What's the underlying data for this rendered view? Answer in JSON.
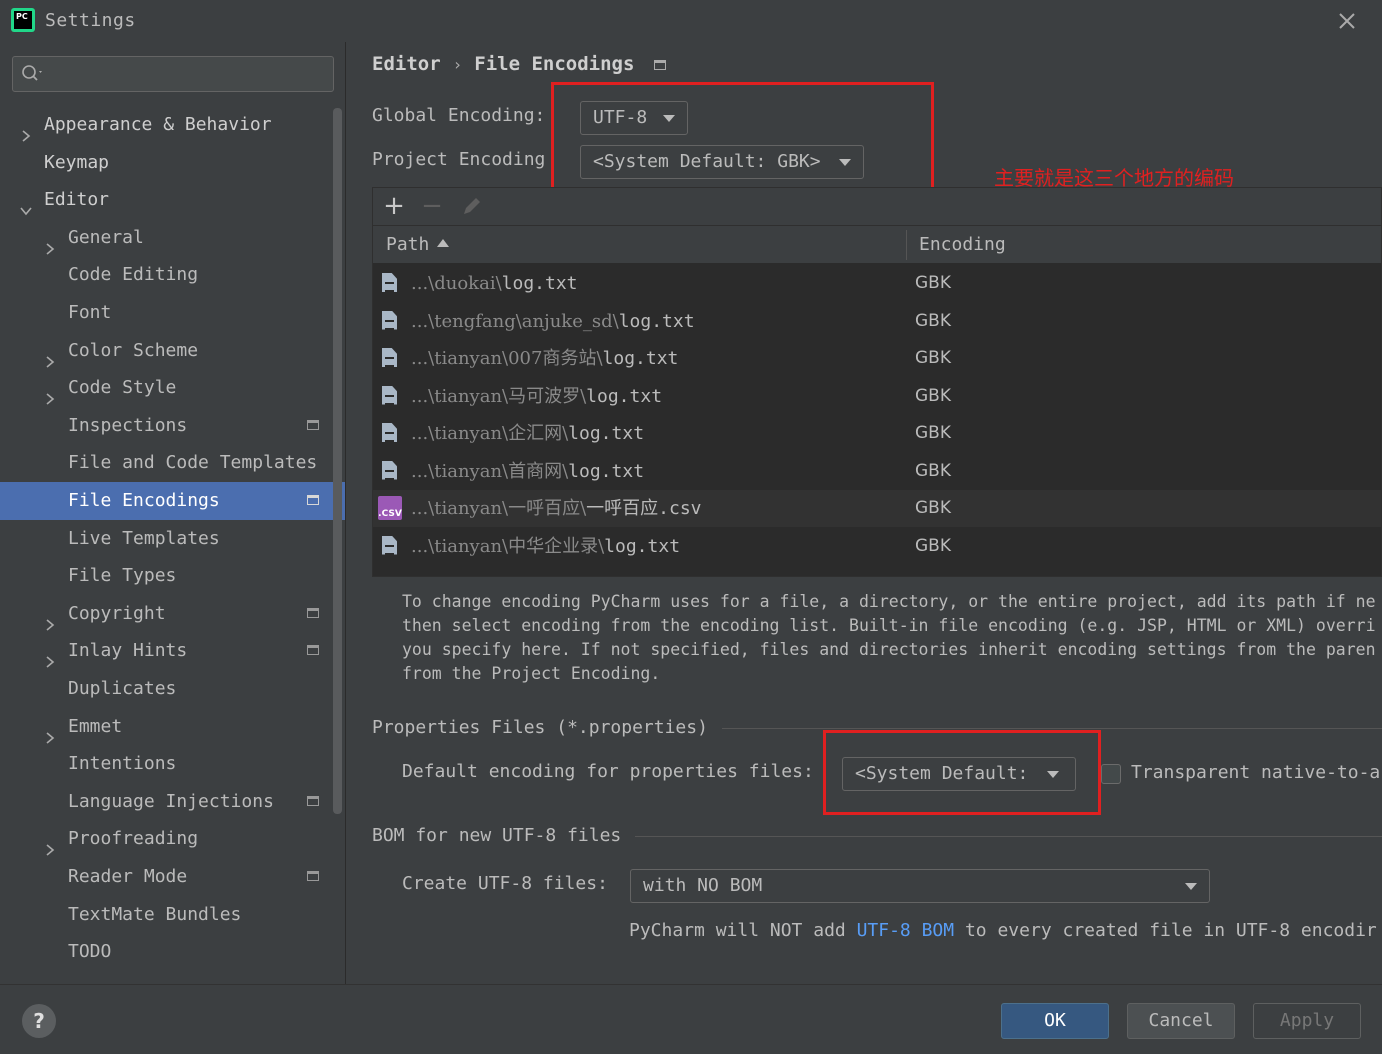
{
  "window": {
    "title": "Settings",
    "app_logo_text": "PC"
  },
  "search": {
    "placeholder": ""
  },
  "sidebar": {
    "items": [
      {
        "label": "Appearance & Behavior",
        "expandable": true,
        "expanded": false,
        "level": 0,
        "project_icon": false
      },
      {
        "label": "Keymap",
        "expandable": false,
        "level": 0,
        "project_icon": false
      },
      {
        "label": "Editor",
        "expandable": true,
        "expanded": true,
        "level": 0,
        "project_icon": false
      },
      {
        "label": "General",
        "expandable": true,
        "expanded": false,
        "level": 1,
        "project_icon": false
      },
      {
        "label": "Code Editing",
        "expandable": false,
        "level": 1,
        "project_icon": false
      },
      {
        "label": "Font",
        "expandable": false,
        "level": 1,
        "project_icon": false
      },
      {
        "label": "Color Scheme",
        "expandable": true,
        "expanded": false,
        "level": 1,
        "project_icon": false
      },
      {
        "label": "Code Style",
        "expandable": true,
        "expanded": false,
        "level": 1,
        "project_icon": false
      },
      {
        "label": "Inspections",
        "expandable": false,
        "level": 1,
        "project_icon": true
      },
      {
        "label": "File and Code Templates",
        "expandable": false,
        "level": 1,
        "project_icon": false
      },
      {
        "label": "File Encodings",
        "expandable": false,
        "level": 1,
        "project_icon": true,
        "selected": true
      },
      {
        "label": "Live Templates",
        "expandable": false,
        "level": 1,
        "project_icon": false
      },
      {
        "label": "File Types",
        "expandable": false,
        "level": 1,
        "project_icon": false
      },
      {
        "label": "Copyright",
        "expandable": true,
        "expanded": false,
        "level": 1,
        "project_icon": true
      },
      {
        "label": "Inlay Hints",
        "expandable": true,
        "expanded": false,
        "level": 1,
        "project_icon": true
      },
      {
        "label": "Duplicates",
        "expandable": false,
        "level": 1,
        "project_icon": false
      },
      {
        "label": "Emmet",
        "expandable": true,
        "expanded": false,
        "level": 1,
        "project_icon": false
      },
      {
        "label": "Intentions",
        "expandable": false,
        "level": 1,
        "project_icon": false
      },
      {
        "label": "Language Injections",
        "expandable": false,
        "level": 1,
        "project_icon": true
      },
      {
        "label": "Proofreading",
        "expandable": true,
        "expanded": false,
        "level": 1,
        "project_icon": false
      },
      {
        "label": "Reader Mode",
        "expandable": false,
        "level": 1,
        "project_icon": true
      },
      {
        "label": "TextMate Bundles",
        "expandable": false,
        "level": 1,
        "project_icon": false
      },
      {
        "label": "TODO",
        "expandable": false,
        "level": 1,
        "project_icon": false
      }
    ]
  },
  "breadcrumb": {
    "parent": "Editor",
    "separator": "›",
    "current": "File Encodings"
  },
  "encoding": {
    "global_label": "Global Encoding:",
    "global_value": "UTF-8",
    "project_label": "Project Encoding",
    "project_value": "<System Default: GBK>"
  },
  "annotation": {
    "text": "主要就是这三个地方的编码",
    "color": "#e02020"
  },
  "table": {
    "toolbar": {
      "add": "+",
      "remove": "−"
    },
    "columns": {
      "path": "Path",
      "encoding": "Encoding"
    },
    "rows": [
      {
        "path_prefix": "...\\duokai\\",
        "file": "log.txt",
        "encoding": "GBK",
        "type": "text"
      },
      {
        "path_prefix": "...\\tengfang\\anjuke_sd\\",
        "file": "log.txt",
        "encoding": "GBK",
        "type": "text"
      },
      {
        "path_prefix": "...\\tianyan\\007商务站\\",
        "file": "log.txt",
        "encoding": "GBK",
        "type": "text"
      },
      {
        "path_prefix": "...\\tianyan\\马可波罗\\",
        "file": "log.txt",
        "encoding": "GBK",
        "type": "text"
      },
      {
        "path_prefix": "...\\tianyan\\企汇网\\",
        "file": "log.txt",
        "encoding": "GBK",
        "type": "text"
      },
      {
        "path_prefix": "...\\tianyan\\首商网\\",
        "file": "log.txt",
        "encoding": "GBK",
        "type": "text"
      },
      {
        "path_prefix": "...\\tianyan\\一呼百应\\",
        "file": "一呼百应.csv",
        "encoding": "GBK",
        "type": "csv",
        "highlighted": true
      },
      {
        "path_prefix": "...\\tianyan\\中华企业录\\",
        "file": "log.txt",
        "encoding": "GBK",
        "type": "text"
      }
    ],
    "csv_icon_label": ".CSV"
  },
  "info_text": "To change encoding PyCharm uses for a file, a directory, or the entire project, add its path if ne\nthen select encoding from the encoding list. Built-in file encoding (e.g. JSP, HTML or XML) overri\nyou specify here. If not specified, files and directories inherit encoding settings from the paren\nfrom the Project Encoding.",
  "properties": {
    "section_title": "Properties Files (*.properties)",
    "label": "Default encoding for properties files:",
    "value": "<System Default: ",
    "transparent_label": "Transparent native-to-a",
    "transparent_checked": false
  },
  "bom": {
    "section_title": "BOM for new UTF-8 files",
    "label": "Create UTF-8 files:",
    "value": "with NO BOM",
    "note_prefix": "PyCharm will NOT add ",
    "note_link": "UTF-8 BOM",
    "note_suffix": " to every created file in UTF-8 encodir"
  },
  "footer": {
    "help": "?",
    "ok": "OK",
    "cancel": "Cancel",
    "apply": "Apply"
  },
  "colors": {
    "background": "#3c3f41",
    "selection": "#4b6eaf",
    "primary_button": "#365880",
    "link": "#589df6",
    "annotation_red": "#e02020"
  }
}
